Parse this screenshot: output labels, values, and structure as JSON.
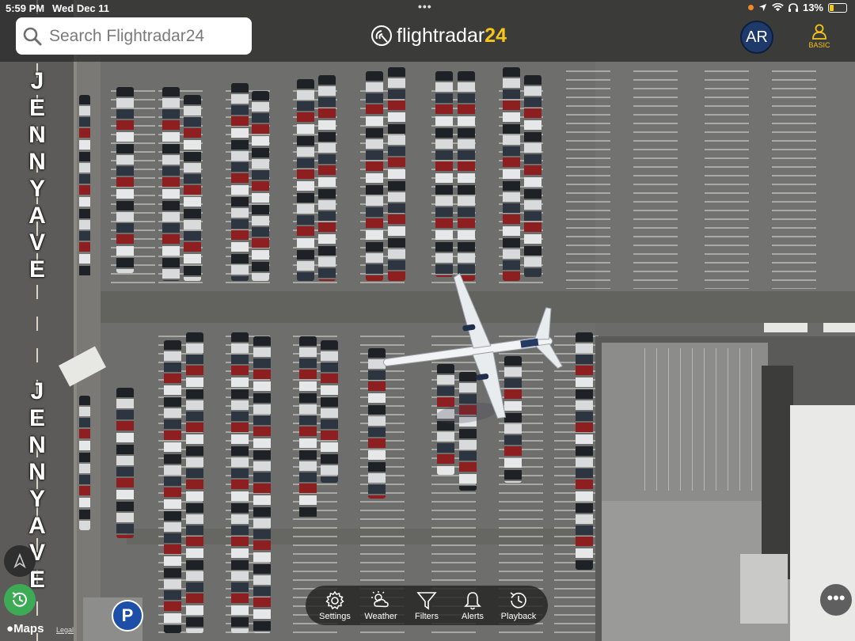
{
  "status_bar": {
    "time": "5:59 PM",
    "date": "Wed Dec 11",
    "multitask_dots": "•••",
    "battery": "13%",
    "battery_fill": 0.13
  },
  "search": {
    "placeholder": "Search Flightradar24"
  },
  "logo": {
    "text_main": "flightradar",
    "text_accent": "24"
  },
  "header_buttons": {
    "ar": "AR",
    "plan": "BASIC"
  },
  "map": {
    "street_name": "JENNY AVE",
    "parking_symbol": "P",
    "attribution": "Maps",
    "legal": "Legal"
  },
  "toolbar": [
    {
      "label": "Settings",
      "icon": "gear-icon"
    },
    {
      "label": "Weather",
      "icon": "weather-icon"
    },
    {
      "label": "Filters",
      "icon": "filter-icon"
    },
    {
      "label": "Alerts",
      "icon": "bell-icon"
    },
    {
      "label": "Playback",
      "icon": "history-icon"
    }
  ],
  "more": "•••",
  "colors": {
    "accent": "#f5c518",
    "playback_green": "#3daa55",
    "ar_blue": "#1d3a6b"
  }
}
